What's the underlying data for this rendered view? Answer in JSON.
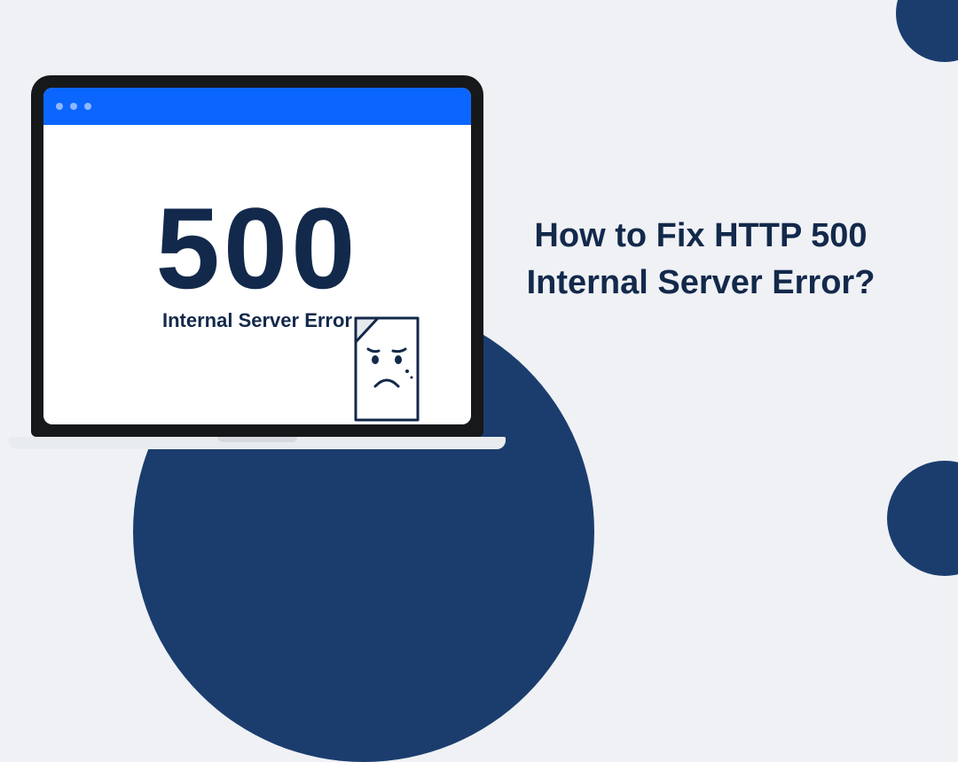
{
  "headline": {
    "line1": "How to Fix HTTP 500",
    "line2": "Internal Server Error?"
  },
  "laptop_screen": {
    "error_code": "500",
    "error_text": "Internal Server Error"
  },
  "colors": {
    "accent_blue": "#0b66ff",
    "dark_navy": "#13294b",
    "circle_navy": "#1b3d6e",
    "background": "#eff1f5"
  }
}
